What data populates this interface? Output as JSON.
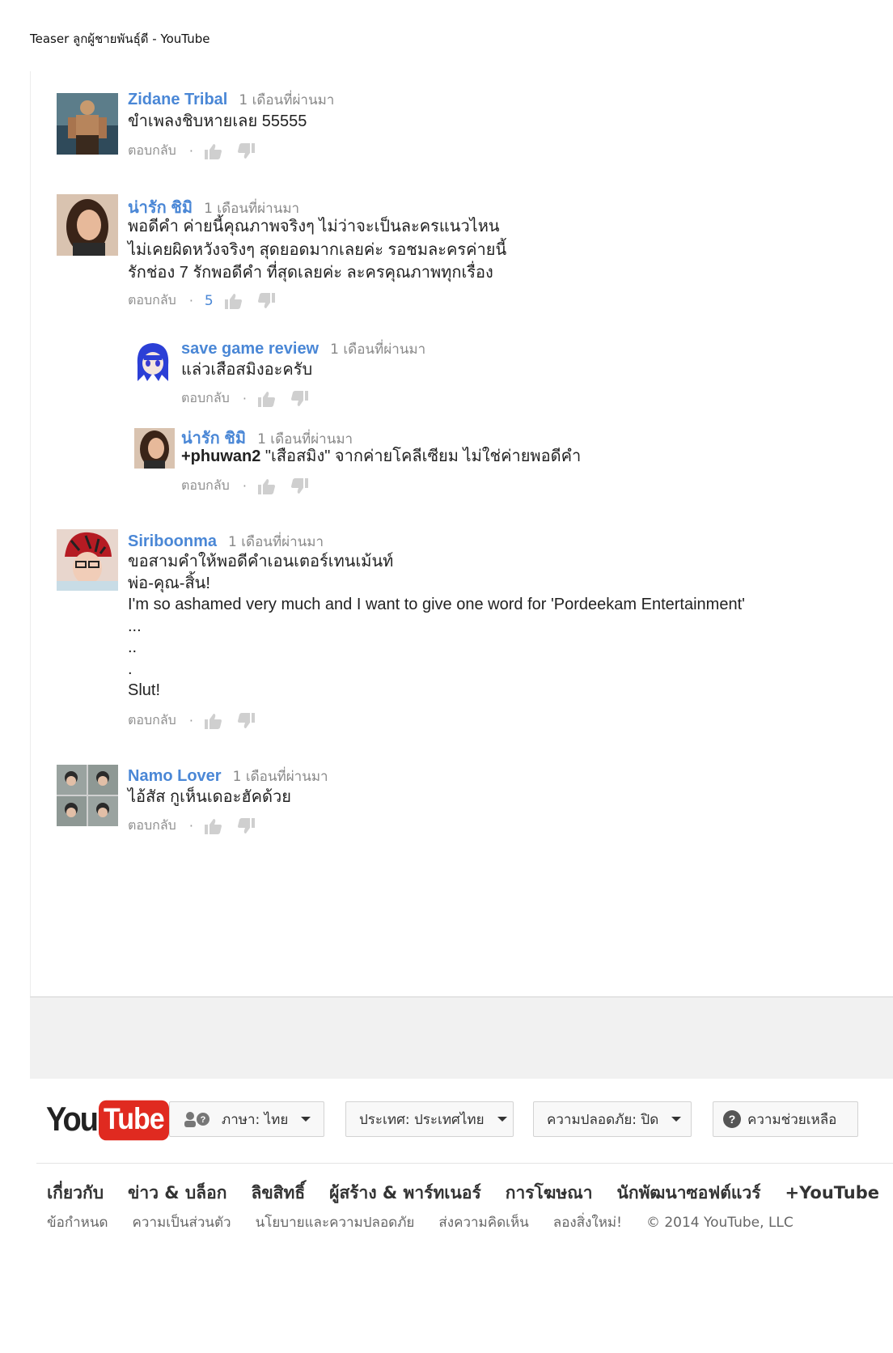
{
  "window": {
    "title": "Teaser ลูกผู้ชายพันธุ์ดี - YouTube"
  },
  "comments": [
    {
      "author": "Zidane Tribal",
      "time": "1 เดือนที่ผ่านมา",
      "text": "ขำเพลงชิบหายเลย 55555",
      "reply_label": "ตอบกลับ",
      "likes": "",
      "avatar": "warrior-avatar"
    },
    {
      "author": "น่ารัก ชิมิ",
      "time": "1 เดือนที่ผ่านมา",
      "text": "พอดีคำ ค่ายนี้คุณภาพจริงๆ ไม่ว่าจะเป็นละครแนวไหน\nไม่เคยผิดหวังจริงๆ สุดยอดมากเลยค่ะ รอชมละครค่ายนี้\nรักช่อง 7 รักพอดีคำ ที่สุดเลยค่ะ ละครคุณภาพทุกเรื่อง",
      "reply_label": "ตอบกลับ",
      "likes": "5",
      "avatar": "woman-avatar"
    },
    {
      "author": "save game review",
      "time": "1 เดือนที่ผ่านมา",
      "text": "แล่วเสือสมิงอะครับ",
      "reply_label": "ตอบกลับ",
      "likes": "",
      "avatar": "anime-avatar"
    },
    {
      "author": "น่ารัก ชิมิ",
      "time": "1 เดือนที่ผ่านมา",
      "mention": "+phuwan2",
      "text": " \"เสือสมิง\" จากค่ายโคลีเซียม ไม่ใช่ค่ายพอดีคำ",
      "reply_label": "ตอบกลับ",
      "likes": "",
      "avatar": "woman-avatar"
    },
    {
      "author": "Siriboonma",
      "time": "1 เดือนที่ผ่านมา",
      "text": "ขอสามคำให้พอดีคำเอนเตอร์เทนเม้นท์\nพ่อ-คุณ-สิ้น!\nI'm so ashamed very much and I want to give one word for 'Pordeekam Entertainment'\n...\n..\n.\nSlut!",
      "reply_label": "ตอบกลับ",
      "likes": "",
      "avatar": "red-hat-avatar"
    },
    {
      "author": "Namo Lover",
      "time": "1 เดือนที่ผ่านมา",
      "text": "ไอ้สัส กูเห็นเดอะฮัคด้วย",
      "reply_label": "ตอบกลับ",
      "likes": "",
      "avatar": "photo-grid-avatar"
    }
  ],
  "footer": {
    "logo_you": "You",
    "logo_tube": "Tube",
    "language_btn": "ภาษา: ไทย",
    "country_btn": "ประเทศ: ประเทศไทย",
    "safety_btn": "ความปลอดภัย: ปิด",
    "help_btn": "ความช่วยเหลือ",
    "links_primary": [
      "เกี่ยวกับ",
      "ข่าว & บล็อก",
      "ลิขสิทธิ์",
      "ผู้สร้าง & พาร์ทเนอร์",
      "การโฆษณา",
      "นักพัฒนาซอฟต์แวร์",
      "+YouTube"
    ],
    "links_secondary": [
      "ข้อกำหนด",
      "ความเป็นส่วนตัว",
      "นโยบายและความปลอดภัย",
      "ส่งความคิดเห็น",
      "ลองสิ่งใหม่!"
    ],
    "copyright": "© 2014 YouTube, LLC"
  },
  "colors": {
    "author_link": "#4a87d6",
    "logo_red": "#e02a20",
    "band_grey": "#f1f1f1"
  }
}
